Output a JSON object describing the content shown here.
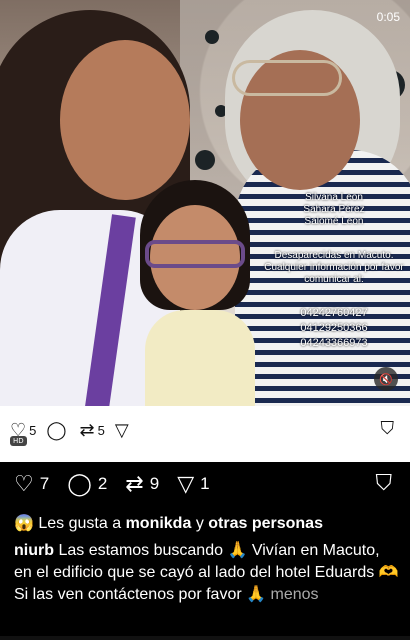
{
  "status": {
    "time": "0:05"
  },
  "overlay": {
    "names": [
      "Silvana Leon",
      "Sahara Pérez",
      "Salomé Leon"
    ],
    "notice": [
      "Desaparecidas en Macuto.",
      "Cualquier información por favor",
      "comunicar al:"
    ],
    "phones": [
      "04242760427",
      "04129250366",
      "04243366973"
    ]
  },
  "embed_actions": {
    "likes": "5",
    "shares": "5",
    "hd_label": "HD"
  },
  "actions": {
    "likes": "7",
    "comments": "2",
    "reposts": "9",
    "shares": "1"
  },
  "likes_line": {
    "prefix": "Les gusta a",
    "user": "monikda",
    "joiner": "y",
    "others": "otras personas"
  },
  "caption": {
    "username": "niurb",
    "text": "Las estamos buscando 🙏 Vivían en Macuto, en el edificio que se cayó al lado del hotel Eduards 🫶 Si las ven contáctenos por favor 🙏",
    "more": "menos"
  },
  "icons": {
    "heart": "heart-icon",
    "comment": "comment-icon",
    "repost": "repost-icon",
    "send": "send-icon",
    "bookmark": "bookmark-icon",
    "mute": "mute-icon"
  }
}
